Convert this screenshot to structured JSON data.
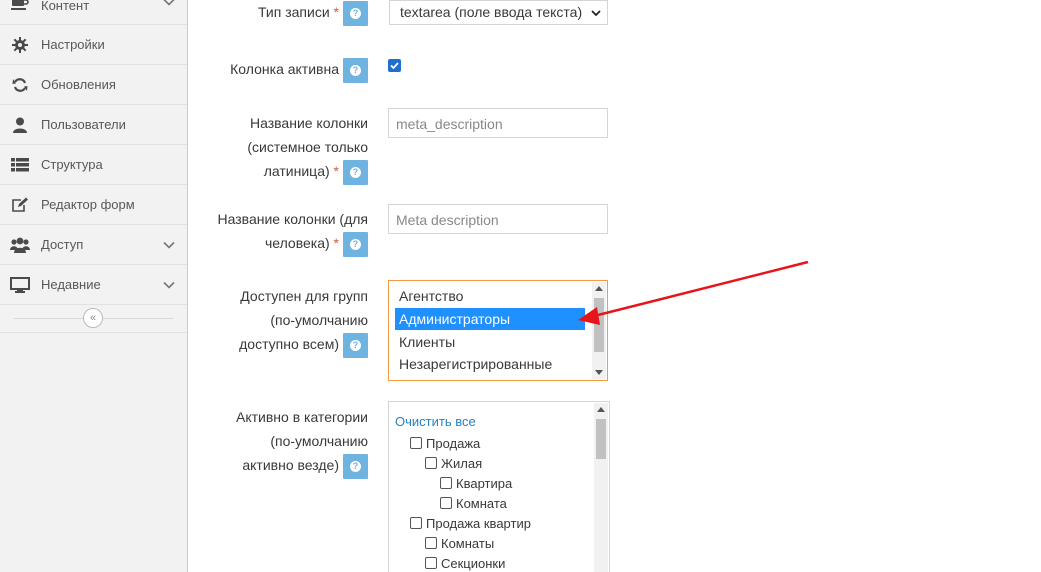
{
  "sidebar": {
    "items": [
      {
        "label": "Контент",
        "icon": "coffee-icon",
        "has_chevron": true
      },
      {
        "label": "Настройки",
        "icon": "gear-icon",
        "has_chevron": false
      },
      {
        "label": "Обновления",
        "icon": "refresh-icon",
        "has_chevron": false
      },
      {
        "label": "Пользователи",
        "icon": "user-icon",
        "has_chevron": false
      },
      {
        "label": "Структура",
        "icon": "list-icon",
        "has_chevron": false
      },
      {
        "label": "Редактор форм",
        "icon": "edit-icon",
        "has_chevron": false
      },
      {
        "label": "Доступ",
        "icon": "users-icon",
        "has_chevron": true
      },
      {
        "label": "Недавние",
        "icon": "desktop-icon",
        "has_chevron": true
      }
    ],
    "collapse_symbol": "«"
  },
  "form": {
    "record_type": {
      "label": "Тип записи",
      "required_mark": "*",
      "value": "textarea (поле ввода текста)"
    },
    "column_active": {
      "label": "Колонка активна",
      "checked": true
    },
    "column_name": {
      "label_line1": "Название колонки",
      "label_line2": "(системное только",
      "label_line3": "латиница)",
      "required_mark": "*",
      "placeholder": "meta_description"
    },
    "column_human": {
      "label_line1": "Название колонки (для",
      "label_line2": "человека)",
      "required_mark": "*",
      "placeholder": "Meta description"
    },
    "groups": {
      "label_line1": "Доступен для групп",
      "label_line2": "(по-умолчанию",
      "label_line3": "доступно всем)",
      "options": [
        "Агентство",
        "Администраторы",
        "Клиенты",
        "Незарегистрированные"
      ],
      "selected_index": 1
    },
    "categories": {
      "label_line1": "Активно в категории",
      "label_line2": "(по-умолчанию",
      "label_line3": "активно везде)",
      "clear_all": "Очистить все",
      "tree": [
        {
          "label": "Продажа",
          "level": 0
        },
        {
          "label": "Жилая",
          "level": 1
        },
        {
          "label": "Квартира",
          "level": 2
        },
        {
          "label": "Комната",
          "level": 2
        },
        {
          "label": "Продажа квартир",
          "level": 0
        },
        {
          "label": "Комнаты",
          "level": 1
        },
        {
          "label": "Секционки",
          "level": 1
        }
      ]
    },
    "help_symbol": "?"
  },
  "colors": {
    "help_button": "#6fb3e0",
    "selected_option": "#1e90ff",
    "focus_border": "#f59942",
    "required": "#d15b47",
    "link": "#2283c5",
    "annotation_arrow": "#e8141b"
  }
}
